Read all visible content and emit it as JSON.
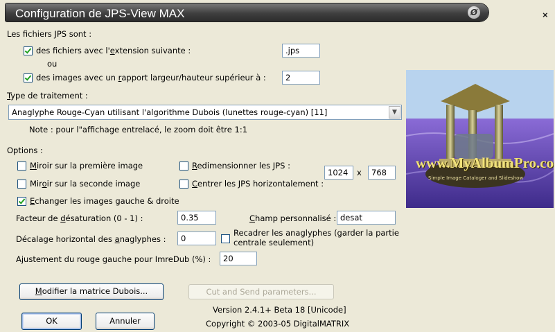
{
  "window": {
    "title": "Configuration de JPS-View MAX",
    "close_glyph": "×"
  },
  "files_section": {
    "label": "Les fichiers JPS sont :",
    "ext_option": {
      "label_pre": "des fichiers avec l'",
      "label_u": "e",
      "label_post": "xtension suivante :",
      "checked": true,
      "value": ".jps"
    },
    "or_label": "ou",
    "ratio_option": {
      "label_pre": "des images avec un ",
      "label_u": "r",
      "label_post": "apport largeur/hauteur supérieur à :",
      "checked": true,
      "value": "2"
    }
  },
  "treatment": {
    "label_u": "T",
    "label_post": "ype de traitement :",
    "selected": "Anaglyphe Rouge-Cyan utilisant l'algorithme Dubois (lunettes rouge-cyan)  [11]",
    "note": "Note : pour l\"affichage entrelacé, le zoom doit être 1:1"
  },
  "options": {
    "label": "Options :",
    "mirror_first": {
      "label_u": "M",
      "label_post": "iroir sur la première image",
      "checked": false
    },
    "mirror_second": {
      "label_pre": "Mir",
      "label_u": "o",
      "label_post": "ir sur la seconde image",
      "checked": false
    },
    "resize": {
      "label_u": "R",
      "label_post": "edimensionner les JPS :",
      "checked": false
    },
    "center": {
      "label_u": "C",
      "label_post": "entrer les JPS horizontalement :",
      "checked": false
    },
    "width": "1024",
    "times": "x",
    "height": "768",
    "swap": {
      "label_u": "E",
      "label_post": "changer les images gauche & droite",
      "checked": true
    },
    "desat": {
      "label_pre": "Facteur de ",
      "label_u": "d",
      "label_post": "ésaturation (0 - 1) :",
      "value": "0.35"
    },
    "custom": {
      "label_u": "C",
      "label_post": "hamp personnalisé :",
      "value": "desat"
    },
    "offset": {
      "label_pre": "Décalage horizontal des ",
      "label_u": "a",
      "label_post": "naglyphes :",
      "value": "0"
    },
    "recenter": {
      "line1": "Recadrer les anaglyphes (garder la partie",
      "line2": "centrale seulement)",
      "checked": false
    },
    "red_adjust": {
      "label": "Ajustement du rouge gauche pour ImreDub (%) :",
      "value": "20"
    }
  },
  "buttons": {
    "dubois_u": "M",
    "dubois_post": "odifier la matrice Dubois...",
    "cut_send": "Cut and Send parameters...",
    "ok": "OK",
    "cancel": "Annuler"
  },
  "footer": {
    "version": "Version 2.4.1+ Beta 18 [Unicode]",
    "copyright": "Copyright © 2003-05 DigitalMATRIX"
  },
  "logo": {
    "text": "www.MyAlbumPro.com",
    "subtitle": "Simple Image Cataloger and Slideshow"
  },
  "icons": {
    "title_icon": "jps-view-logo-icon",
    "close": "close-icon",
    "dropdown": "chevron-down-icon"
  },
  "colors": {
    "title_bar": "#3f3f3f",
    "dialog_bg": "#ece9d8",
    "input_border": "#7f9db9",
    "check": "#21a121"
  }
}
